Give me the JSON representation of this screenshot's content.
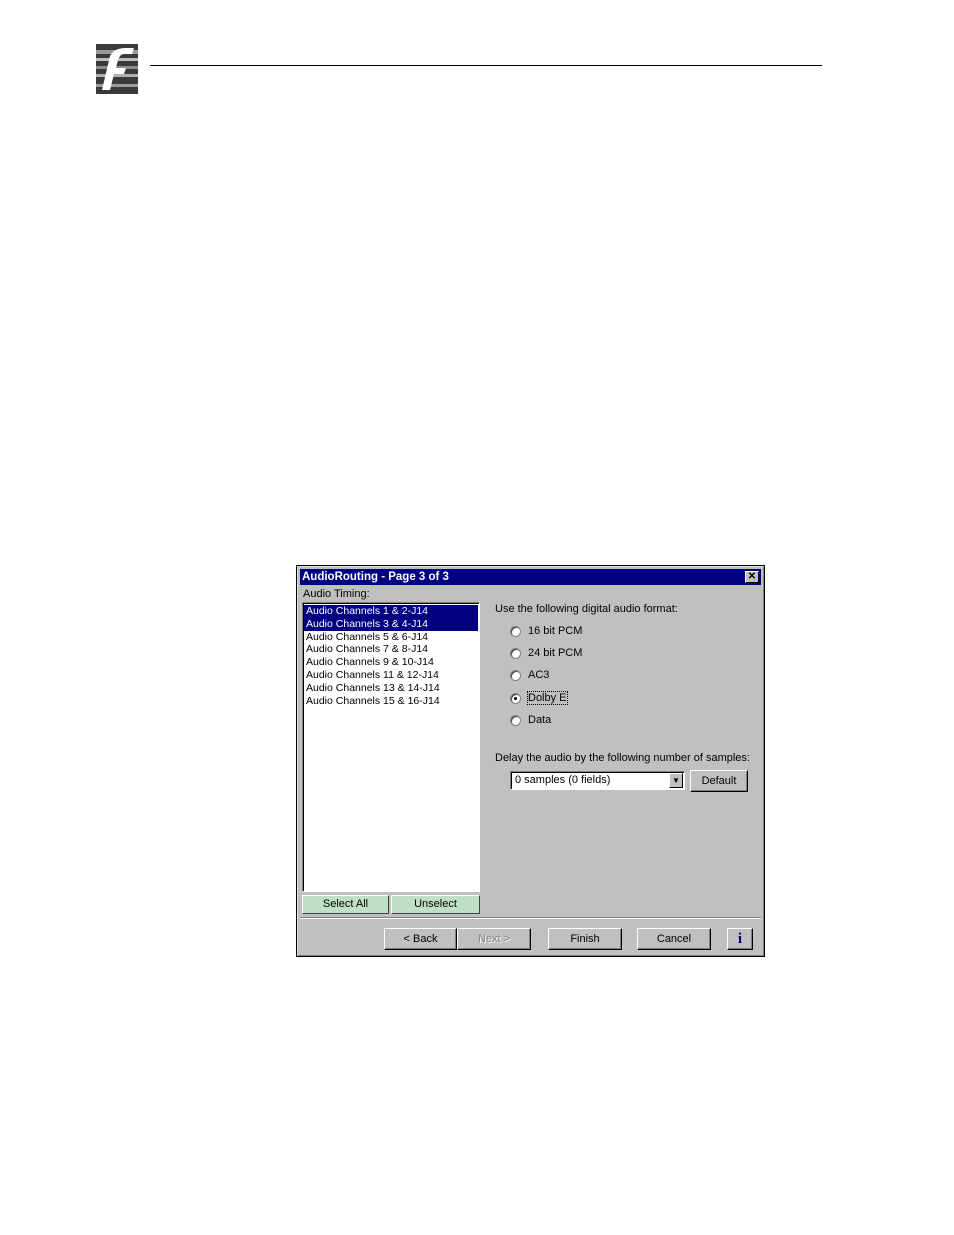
{
  "dialog": {
    "title": "AudioRouting - Page 3 of 3",
    "close_glyph": "✕",
    "audio_timing_label": "Audio Timing:",
    "channels": [
      {
        "label": "Audio Channels 1 & 2-J14",
        "selected": true
      },
      {
        "label": "Audio Channels 3 & 4-J14",
        "selected": true
      },
      {
        "label": "Audio Channels 5 & 6-J14",
        "selected": false
      },
      {
        "label": "Audio Channels 7 & 8-J14",
        "selected": false
      },
      {
        "label": "Audio Channels 9 & 10-J14",
        "selected": false
      },
      {
        "label": "Audio Channels 11 & 12-J14",
        "selected": false
      },
      {
        "label": "Audio Channels 13 & 14-J14",
        "selected": false
      },
      {
        "label": "Audio Channels 15 & 16-J14",
        "selected": false
      }
    ],
    "select_all_label": "Select All",
    "unselect_label": "Unselect",
    "format_label": "Use the following digital audio format:",
    "formats": [
      {
        "label": "16 bit PCM",
        "checked": false
      },
      {
        "label": "24 bit PCM",
        "checked": false
      },
      {
        "label": "AC3",
        "checked": false
      },
      {
        "label": "Dolby E",
        "checked": true
      },
      {
        "label": "Data",
        "checked": false
      }
    ],
    "delay_label": "Delay the audio by the following number of samples:",
    "delay_value": "0 samples (0 fields)",
    "default_label": "Default",
    "back_label": "< Back",
    "next_label": "Next >",
    "finish_label": "Finish",
    "cancel_label": "Cancel",
    "info_label": "i"
  }
}
